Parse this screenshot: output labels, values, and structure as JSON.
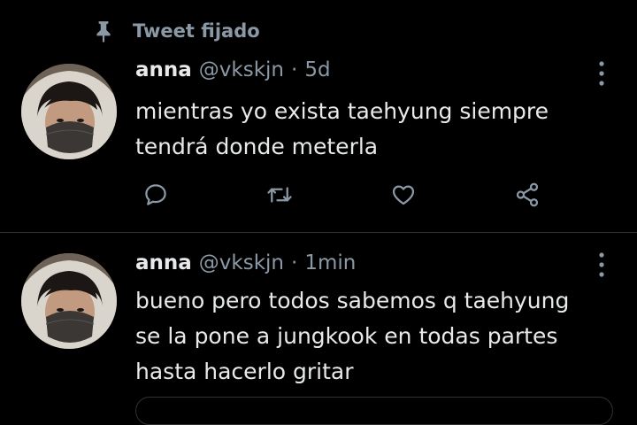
{
  "pinned": {
    "label": "Tweet fijado",
    "icon": "pin-icon"
  },
  "colors": {
    "background": "#000000",
    "text": "#e7e9ea",
    "secondary": "#8b98a5",
    "divider": "#2f3336"
  },
  "tweets": [
    {
      "name": "anna",
      "handle": "@vkskjn",
      "separator": "·",
      "time": "5d",
      "text": "mientras yo exista taehyung siempre\ntendrá donde meterla",
      "actions": [
        "reply-icon",
        "retweet-icon",
        "like-icon",
        "share-icon"
      ]
    },
    {
      "name": "anna",
      "handle": "@vkskjn",
      "separator": "·",
      "time": "1min",
      "text": "bueno pero todos sabemos q taehyung\nse la pone a jungkook en todas partes\nhasta hacerlo gritar"
    }
  ]
}
